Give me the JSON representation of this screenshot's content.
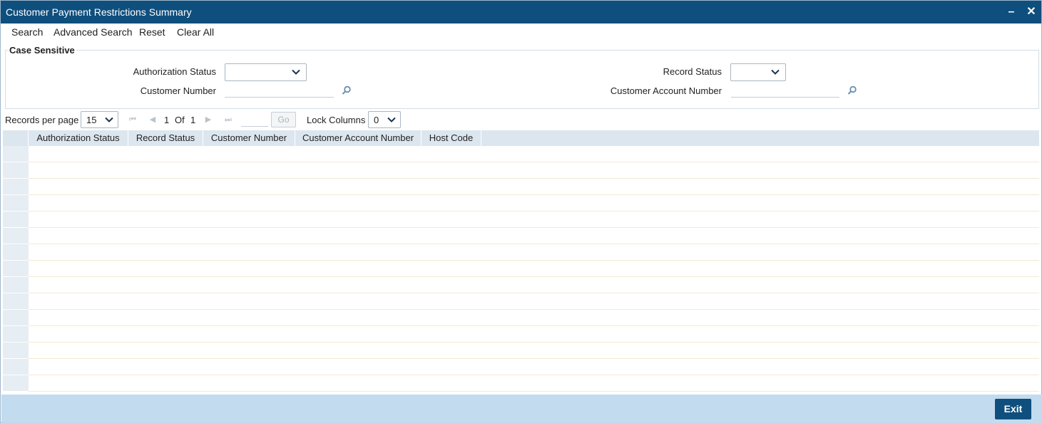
{
  "window": {
    "title": "Customer Payment Restrictions Summary"
  },
  "toolbar": {
    "search": "Search",
    "advanced_search": "Advanced Search",
    "reset": "Reset",
    "clear_all": "Clear All"
  },
  "criteria": {
    "legend": "Case Sensitive",
    "authorization_status": {
      "label": "Authorization Status",
      "value": ""
    },
    "record_status": {
      "label": "Record Status",
      "value": ""
    },
    "customer_number": {
      "label": "Customer Number",
      "value": ""
    },
    "customer_account_number": {
      "label": "Customer Account Number",
      "value": ""
    }
  },
  "pager": {
    "records_per_page_label": "Records per page",
    "records_per_page": "15",
    "current_page": "1",
    "of_label": "Of",
    "total_pages": "1",
    "go_label": "Go",
    "lock_columns_label": "Lock Columns",
    "lock_columns": "0"
  },
  "grid": {
    "columns": [
      "Authorization Status",
      "Record Status",
      "Customer Number",
      "Customer Account Number",
      "Host Code"
    ],
    "row_count": 15
  },
  "footer": {
    "exit_label": "Exit"
  },
  "colors": {
    "titlebar": "#0f4f7e",
    "footer": "#c2dbee",
    "grid_header": "#dce6ef"
  },
  "icons": {
    "minimize": "minimize-icon",
    "close": "close-icon",
    "lookup": "magnifier-icon",
    "dropdown": "chevron-down-icon"
  }
}
